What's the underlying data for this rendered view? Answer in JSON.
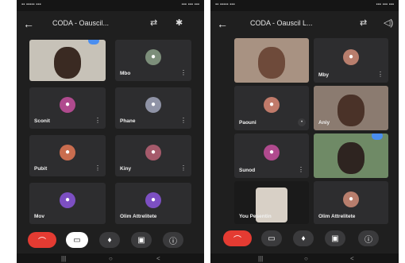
{
  "left": {
    "title": "CODA - Oauscil...",
    "tiles": [
      {
        "label": "",
        "name": "video-tile",
        "badge": "blue"
      },
      {
        "label": "Mbo",
        "name": "participant-mbo"
      },
      {
        "label": "Sconit",
        "name": "participant-sconit"
      },
      {
        "label": "Phane",
        "name": "participant-phane"
      },
      {
        "label": "Pubit",
        "name": "participant-pubit"
      },
      {
        "label": "Kiny",
        "name": "participant-kiny"
      },
      {
        "label": "Mov",
        "name": "participant-mov"
      },
      {
        "label": "Olim Attrelitete",
        "name": "participant-olim"
      }
    ]
  },
  "right": {
    "title": "CODA - Oauscil L...",
    "tiles": [
      {
        "label": "",
        "name": "video-tile-1"
      },
      {
        "label": "Mby",
        "name": "participant-mby"
      },
      {
        "label": "Paouni",
        "name": "participant-paouni"
      },
      {
        "label": "Aniy",
        "name": "video-tile-2"
      },
      {
        "label": "Sunod",
        "name": "participant-sunod"
      },
      {
        "label": "",
        "name": "video-tile-3"
      },
      {
        "label": "You Pesentin",
        "name": "self-video-tile"
      },
      {
        "label": "Olim Attrelitete",
        "name": "participant-olim"
      }
    ]
  },
  "icons": {
    "back": "arrow-left-icon",
    "switch": "switch-camera-icon",
    "audio": "speaker-icon",
    "end": "end-call-icon",
    "camera": "camera-icon",
    "mic": "mic-icon",
    "present": "present-icon",
    "info": "info-icon"
  }
}
